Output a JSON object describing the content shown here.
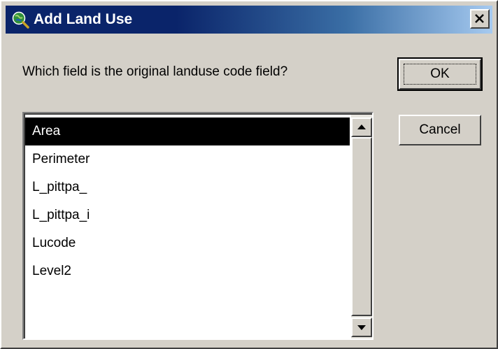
{
  "window": {
    "title": "Add Land Use",
    "app_icon": "magnifier-globe-icon",
    "close_icon": "close-x-icon"
  },
  "dialog": {
    "prompt": "Which field is the original landuse code field?",
    "fields": [
      {
        "label": "Area",
        "selected": true
      },
      {
        "label": "Perimeter",
        "selected": false
      },
      {
        "label": "L_pittpa_",
        "selected": false
      },
      {
        "label": "L_pittpa_i",
        "selected": false
      },
      {
        "label": "Lucode",
        "selected": false
      },
      {
        "label": "Level2",
        "selected": false
      }
    ],
    "ok_label": "OK",
    "cancel_label": "Cancel"
  },
  "colors": {
    "title_bar_start": "#0a246a",
    "title_bar_end": "#a6caf0",
    "face": "#d4d0c8",
    "selection": "#000000"
  }
}
